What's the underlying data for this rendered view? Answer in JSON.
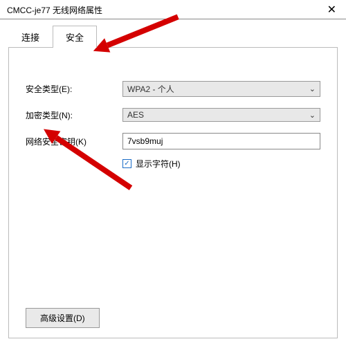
{
  "window": {
    "title": "CMCC-je77 无线网络属性"
  },
  "tabs": {
    "connect": "连接",
    "security": "安全"
  },
  "fields": {
    "securityType": {
      "label": "安全类型(E):",
      "value": "WPA2 - 个人"
    },
    "encryption": {
      "label": "加密类型(N):",
      "value": "AES"
    },
    "networkKey": {
      "label": "网络安全密钥(K)",
      "value": "7vsb9muj"
    },
    "showChars": {
      "label": "显示字符(H)",
      "checked": true
    }
  },
  "buttons": {
    "advanced": "高级设置(D)"
  }
}
